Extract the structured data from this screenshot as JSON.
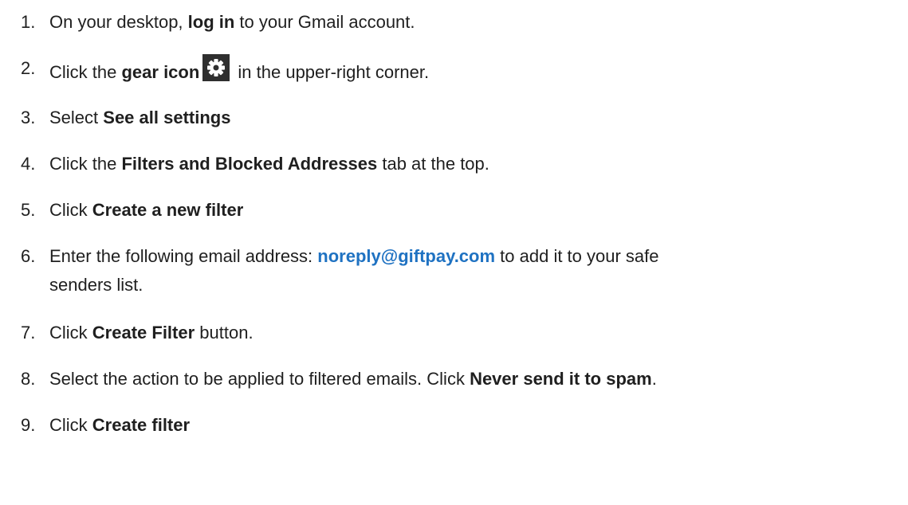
{
  "steps": [
    {
      "num": "1.",
      "p1": "On your desktop, ",
      "b1": "log in",
      "p2": " to your Gmail account."
    },
    {
      "num": "2.",
      "p1": "Click the ",
      "b1": "gear icon",
      "icon": "gear-icon",
      "p2": " in the upper-right corner."
    },
    {
      "num": "3.",
      "p1": "Select ",
      "b1": "See all settings"
    },
    {
      "num": "4.",
      "p1": "Click the ",
      "b1": "Filters and Blocked Addresses",
      "p2": " tab at the top."
    },
    {
      "num": "5.",
      "p1": "Click ",
      "b1": "Create a new filter"
    },
    {
      "num": "6.",
      "p1": "Enter the following email address: ",
      "link": "noreply@giftpay.com",
      "p2": " to add it to your safe",
      "p3": "senders list."
    },
    {
      "num": "7.",
      "p1": "Click ",
      "b1": "Create Filter",
      "p2": " button."
    },
    {
      "num": "8.",
      "p1": "Select the action to be applied to filtered emails. Click ",
      "b1": "Never send it to spam",
      "p2": "."
    },
    {
      "num": "9.",
      "p1": "Click ",
      "b1": "Create filter"
    }
  ],
  "colors": {
    "link": "#1f72c2",
    "text": "#1f1f1f",
    "icon_bg": "#2f2f2f"
  }
}
